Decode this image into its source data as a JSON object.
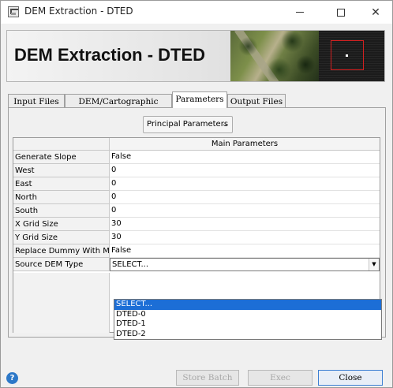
{
  "window": {
    "title": "DEM Extraction - DTED"
  },
  "banner": {
    "title": "DEM Extraction - DTED"
  },
  "tabs": [
    {
      "label": "Input Files",
      "active": false
    },
    {
      "label": "DEM/Cartographic System",
      "active": false
    },
    {
      "label": "Parameters",
      "active": true
    },
    {
      "label": "Output Files",
      "active": false
    }
  ],
  "parameters": {
    "section_dropdown": "Principal Parameters",
    "table_header": "Main Parameters",
    "rows": [
      {
        "label": "Generate Slope",
        "value": "False"
      },
      {
        "label": "West",
        "value": "0"
      },
      {
        "label": "East",
        "value": "0"
      },
      {
        "label": "North",
        "value": "0"
      },
      {
        "label": "South",
        "value": "0"
      },
      {
        "label": "X Grid Size",
        "value": "30"
      },
      {
        "label": "Y Grid Size",
        "value": "30"
      },
      {
        "label": "Replace Dummy With Min",
        "value": "False"
      },
      {
        "label": "Source DEM Type",
        "value": "SELECT..."
      }
    ],
    "dem_type_options": [
      "SELECT...",
      "DTED-0",
      "DTED-1",
      "DTED-2"
    ],
    "dem_type_selected": "SELECT..."
  },
  "buttons": {
    "store_batch": "Store Batch",
    "exec": "Exec",
    "close": "Close",
    "help": "?"
  },
  "colors": {
    "selection": "#1c6ed6",
    "help_icon": "#2d78c8",
    "radar_box": "#d42020"
  }
}
